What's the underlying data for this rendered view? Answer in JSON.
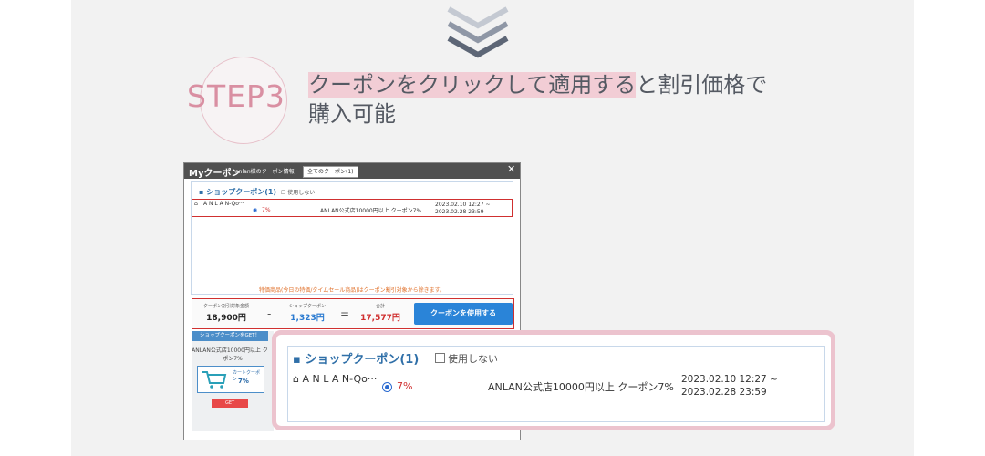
{
  "step": {
    "label": "STEP3"
  },
  "headline": {
    "highlight": "クーポンをクリックして適用する",
    "rest": "と割引価格で",
    "line2": "購入可能"
  },
  "dialog": {
    "title": "Myクーポン",
    "subtitle": "anlan様のクーポン情報",
    "tab": "全てのクーポン(1)",
    "close": "✕",
    "shop_coupon_title": "▪ ショップクーポン(1)",
    "no_use": "使用しない",
    "coupon": {
      "name": "A N L A N-Qo···",
      "percent": "7%",
      "description": "ANLAN公式店10000円以上 クーポン7%",
      "date_start": "2023.02.10 12:27 ~",
      "date_end": "2023.02.28 23:59"
    },
    "notice": "特価商品(今日の特価/タイムセール商品)はクーポン割引対象から除きます。",
    "calc": {
      "target_label": "クーポン割引対象金額",
      "target_value": "18,900円",
      "minus": "-",
      "coupon_label": "ショップクーポン",
      "coupon_value": "1,323円",
      "equals": "=",
      "total_label": "合計",
      "total_value": "17,577円"
    },
    "use_button": "クーポンを使用する",
    "side": {
      "get_banner": "ショップクーポンをGET！",
      "text": "ANLAN公式店10000円以上 クーポン7%",
      "card_label": "カートクーポン",
      "card_percent": "7%",
      "get_button": "GET"
    }
  },
  "zoom": {
    "title": "▪ ショップクーポン(1)",
    "no_use": "使用しない",
    "name": "A N L A N-Qo···",
    "percent": "7%",
    "description": "ANLAN公式店10000円以上 クーポン7%",
    "date_start": "2023.02.10 12:27 ~",
    "date_end": "2023.02.28 23:59"
  },
  "colors": {
    "accent_pink": "#d98fa2",
    "highlight_pink": "#f2cdd5",
    "blue_button": "#2a84d8",
    "red_total": "#d03030"
  }
}
